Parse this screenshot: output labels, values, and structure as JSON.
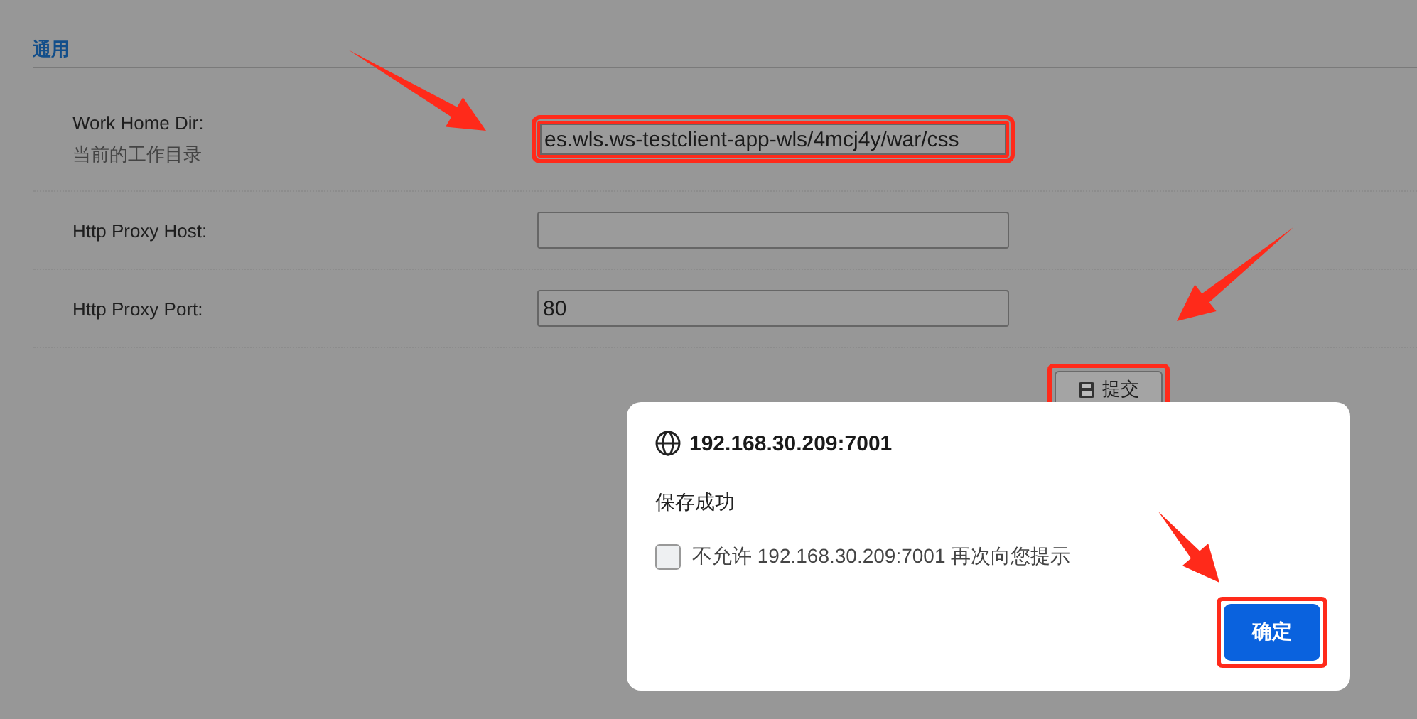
{
  "section": {
    "title": "通用"
  },
  "fields": [
    {
      "label": "Work Home Dir:",
      "hint": "当前的工作目录",
      "value": "es.wls.ws-testclient-app-wls/4mcj4y/war/css",
      "highlighted": true
    },
    {
      "label": "Http Proxy Host:",
      "highlighted": false
    },
    {
      "label": "Http Proxy Port:",
      "value": "80",
      "highlighted": false
    }
  ],
  "submit_button": {
    "label": "提交",
    "highlighted": true
  },
  "dialog": {
    "title": "192.168.30.209:7001",
    "message": "保存成功",
    "checkbox": {
      "label": "不允许 192.168.30.209:7001 再次向您提示",
      "checked": false
    },
    "ok_button": {
      "label": "确定",
      "highlighted": true
    }
  }
}
